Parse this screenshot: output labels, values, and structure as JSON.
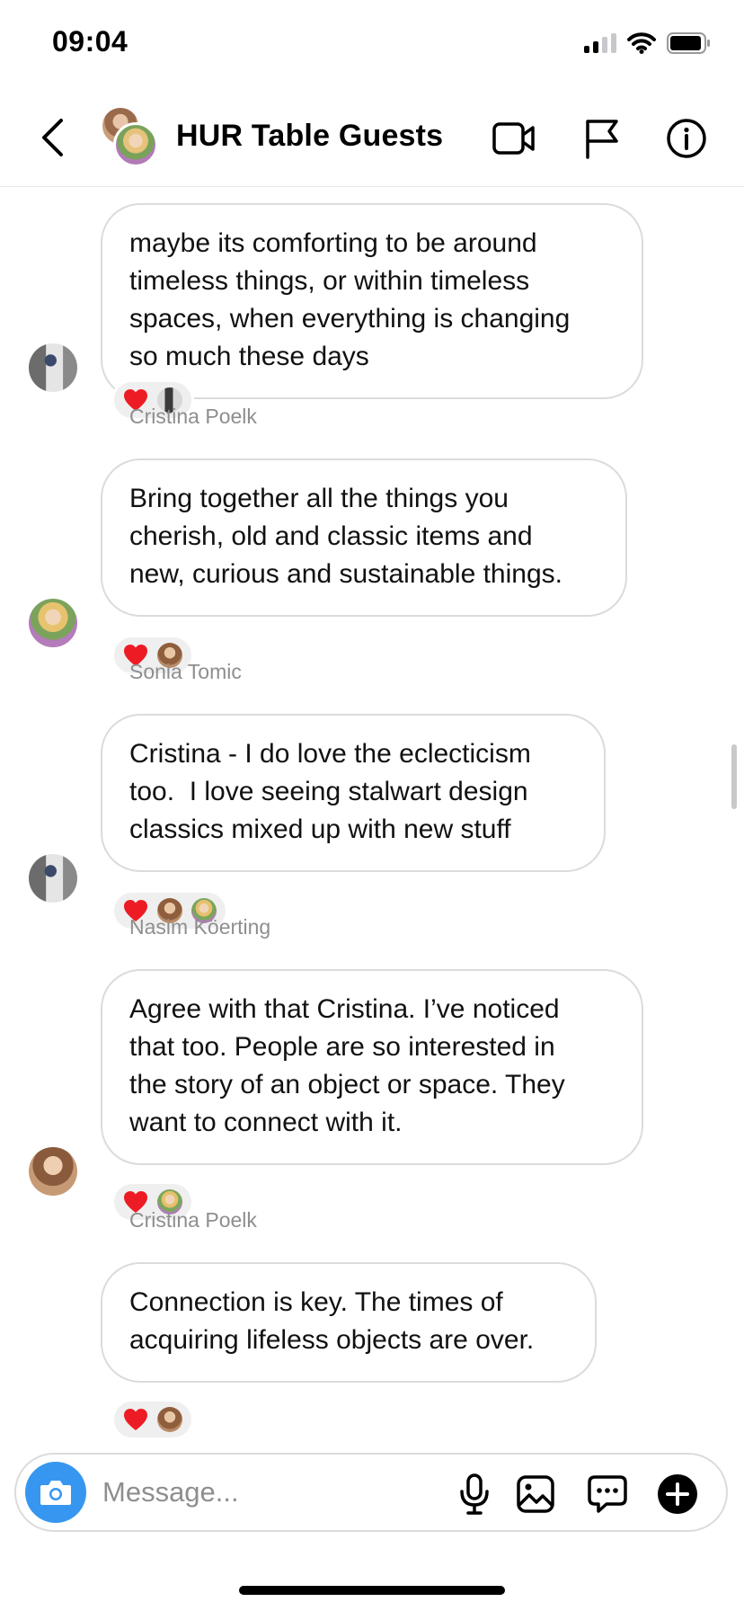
{
  "status_bar": {
    "time": "09:04"
  },
  "header": {
    "title": "HUR Table Guests",
    "icons": [
      "back-chevron-icon",
      "video-camera-icon",
      "flag-icon",
      "info-icon"
    ]
  },
  "messages": [
    {
      "sender": "",
      "avatar": "sonia",
      "lines": [
        "maybe its comforting to be around",
        "timeless things, or within timeless",
        "spaces, when everything is changing",
        "so much these days"
      ],
      "reactions": [
        "heart-icon",
        "reactor-avatar"
      ]
    },
    {
      "sender": "Cristina Poelk",
      "avatar": "cristina",
      "lines": [
        "Bring together all the things you",
        "cherish, old and classic items and",
        "new, curious and sustainable things."
      ],
      "reactions": [
        "heart-icon",
        "reactor-avatar"
      ]
    },
    {
      "sender": "Sonia Tomic",
      "avatar": "sonia",
      "lines": [
        "Cristina - I do love the eclecticism",
        "too.  I love seeing stalwart design",
        "classics mixed up with new stuff"
      ],
      "reactions": [
        "heart-icon",
        "reactor-avatar",
        "reactor-avatar"
      ]
    },
    {
      "sender": "Nasim Köerting",
      "avatar": "nasim",
      "lines": [
        "Agree with that Cristina. I’ve noticed",
        "that too. People are so interested in",
        "the story of an object or space. They",
        "want to connect with it."
      ],
      "reactions": [
        "heart-icon",
        "reactor-avatar"
      ]
    },
    {
      "sender": "Cristina Poelk",
      "avatar": "none",
      "lines": [
        "Connection is key. The times of",
        "acquiring lifeless objects are over."
      ],
      "reactions": [
        "heart-icon",
        "reactor-avatar"
      ]
    }
  ],
  "composer": {
    "placeholder": "Message...",
    "icons": [
      "camera-icon",
      "microphone-icon",
      "gallery-icon",
      "sticker-chat-icon",
      "add-icon"
    ]
  },
  "colors": {
    "accent": "#3797f0",
    "heart": "#ed1c24",
    "meta_text": "#8e8e8e",
    "bubble_border": "#dbdbdb"
  }
}
